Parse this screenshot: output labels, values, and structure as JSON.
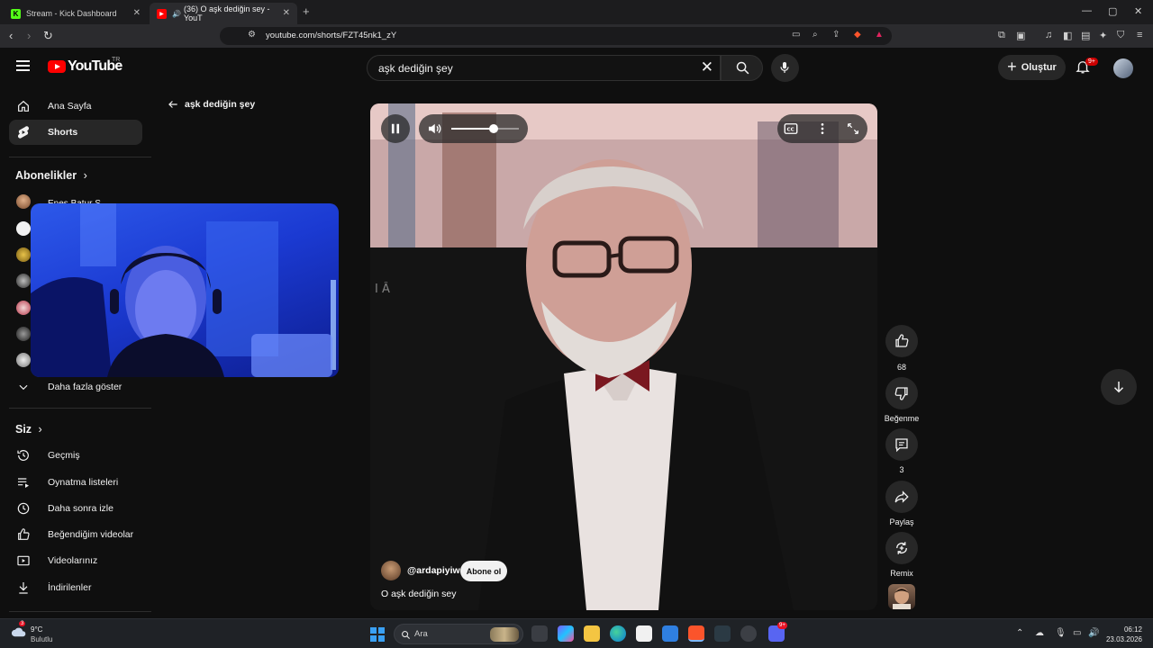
{
  "browser": {
    "tabs": [
      {
        "title": "Stream - Kick Dashboard",
        "favicon_letter": "K"
      },
      {
        "title": "(36) O aşk dediğin sey - YouT",
        "favicon_letter": "▶"
      }
    ],
    "new_tab_glyph": "+",
    "url": "youtube.com/shorts/FZT45nk1_zY"
  },
  "youtube": {
    "logo_text": "YouTube",
    "region": "TR",
    "search_value": "aşk dediğin şey",
    "create_label": "Oluştur",
    "notifications_badge": "9+"
  },
  "sidebar": {
    "main_items": [
      {
        "label": "Ana Sayfa",
        "icon": "home-icon"
      },
      {
        "label": "Shorts",
        "icon": "shorts-icon",
        "active": true
      }
    ],
    "subscriptions_heading": "Abonelikler",
    "subscription_first": "Enes Batur S",
    "show_more": "Daha fazla göster",
    "you_heading": "Siz",
    "you_items": [
      {
        "label": "Geçmiş",
        "icon": "history-icon"
      },
      {
        "label": "Oynatma listeleri",
        "icon": "playlist-icon"
      },
      {
        "label": "Daha sonra izle",
        "icon": "clock-icon"
      },
      {
        "label": "Beğendiğim videolar",
        "icon": "thumb-up-icon"
      },
      {
        "label": "Videolarınız",
        "icon": "video-icon"
      },
      {
        "label": "İndirilenler",
        "icon": "download-icon"
      }
    ]
  },
  "shorts": {
    "back_query": "aşk dediğin şey",
    "volume": 0.62,
    "channel": "@ardapiyiw",
    "subscribe_label": "Abone ol",
    "title": "O aşk dediğin sey",
    "actions": {
      "likes": "68",
      "dislike": "Beğenme",
      "comments": "3",
      "share": "Paylaş",
      "remix": "Remix"
    }
  },
  "taskbar": {
    "weather_badge": "3",
    "temperature": "9°C",
    "weather": "Bulutlu",
    "search_placeholder": "Ara",
    "discord_badge": "9+",
    "time": "06:12",
    "date": "23.03.2026"
  }
}
